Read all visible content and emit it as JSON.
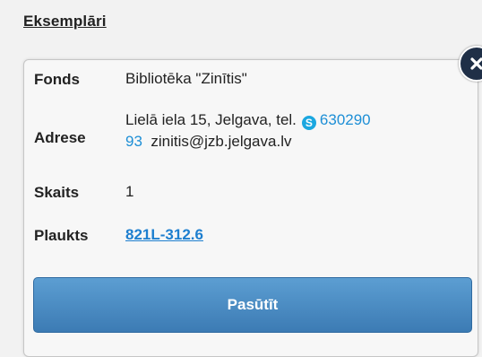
{
  "section": {
    "title": "Eksemplāri"
  },
  "record": {
    "fonds_label": "Fonds",
    "fonds_value": "Bibliotēka \"Zinītis\"",
    "address_label": "Adrese",
    "address_line1": "Lielā iela 15, Jelgava, tel.",
    "phone_part1": "630290",
    "phone_part2": "93",
    "email": "zinitis@jzb.jelgava.lv",
    "count_label": "Skaits",
    "count_value": "1",
    "shelf_label": "Plaukts",
    "shelf_value": "821L-312.6"
  },
  "actions": {
    "order_label": "Pasūtīt"
  },
  "icons": {
    "close": "close-icon",
    "skype": "skype-icon"
  },
  "colors": {
    "accent": "#1e8fd6",
    "button": "#4a8bc4",
    "close_bg": "#1f2f47"
  }
}
